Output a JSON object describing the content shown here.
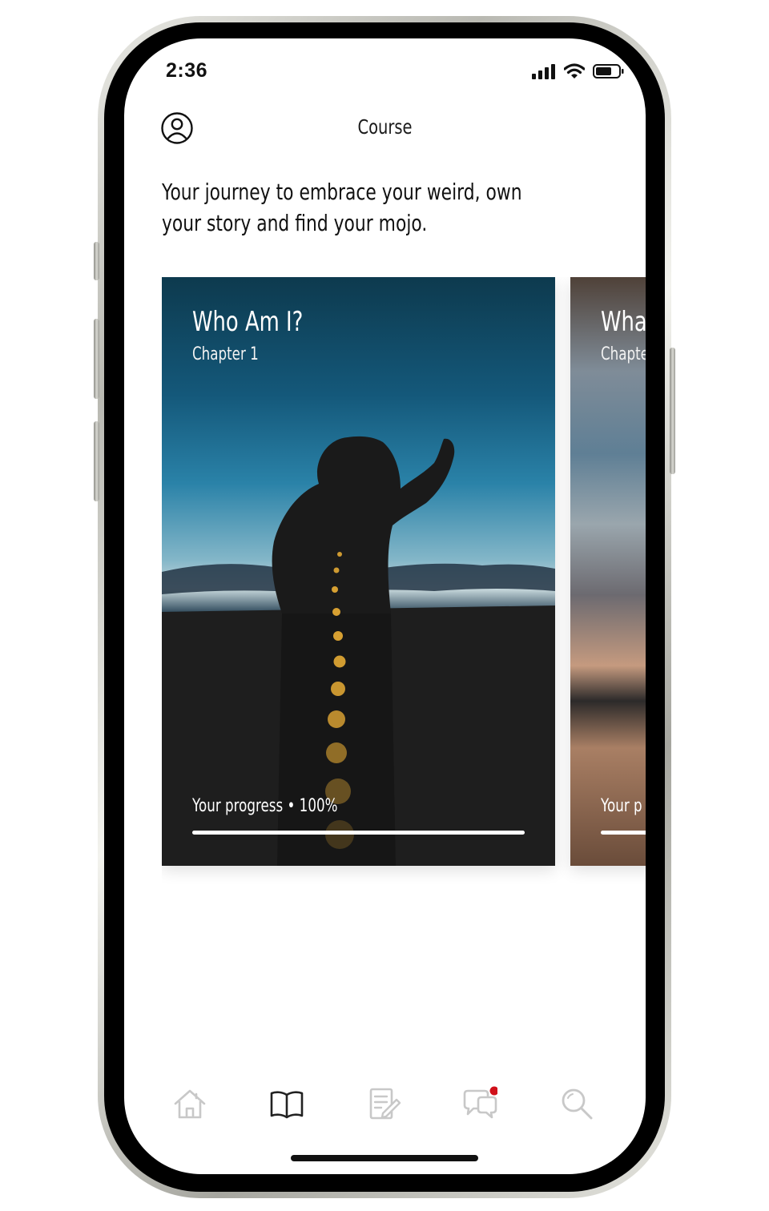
{
  "status_bar": {
    "time": "2:36",
    "icons": [
      "cellular-signal-icon",
      "wifi-icon",
      "battery-icon"
    ]
  },
  "header": {
    "title": "Course",
    "profile_icon": "user-circle-icon"
  },
  "intro_text": "Your journey to embrace your weird, own your story and find your mojo.",
  "cards": [
    {
      "title": "Who Am I?",
      "chapter": "Chapter 1",
      "progress_label": "Your progress • 100%",
      "progress": 1.0
    },
    {
      "title": "Wha",
      "chapter": "Chapte",
      "progress_label": "Your p",
      "progress": 1.0
    }
  ],
  "tabs": [
    {
      "icon": "home-icon",
      "active": false
    },
    {
      "icon": "open-book-icon",
      "active": true
    },
    {
      "icon": "journal-edit-icon",
      "active": false
    },
    {
      "icon": "chat-bubbles-icon",
      "active": false,
      "notification_dot": true
    },
    {
      "icon": "search-icon",
      "active": false
    }
  ],
  "colors": {
    "active_tab": "#222222",
    "inactive_tab": "#c8c8c8",
    "notification": "#d0101a"
  }
}
